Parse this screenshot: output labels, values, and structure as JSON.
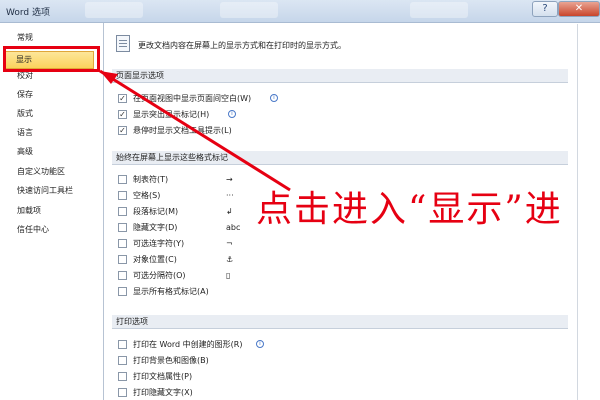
{
  "window": {
    "title": "Word 选项",
    "help_glyph": "?",
    "close_glyph": "✕"
  },
  "sidebar": {
    "items": [
      {
        "label": "常规",
        "selected": false
      },
      {
        "label": "显示",
        "selected": true
      },
      {
        "label": "校对",
        "selected": false
      },
      {
        "label": "保存",
        "selected": false
      },
      {
        "label": "版式",
        "selected": false
      },
      {
        "label": "语言",
        "selected": false
      },
      {
        "label": "高级",
        "selected": false
      },
      {
        "label": "自定义功能区",
        "selected": false
      },
      {
        "label": "快速访问工具栏",
        "selected": false
      },
      {
        "label": "加载项",
        "selected": false
      },
      {
        "label": "信任中心",
        "selected": false
      }
    ]
  },
  "main": {
    "intro": "更改文档内容在屏幕上的显示方式和在打印时的显示方式。",
    "page_display": {
      "header": "页面显示选项",
      "options": [
        {
          "label": "在页面视图中显示页面间空白(W)",
          "checked": true,
          "info": true
        },
        {
          "label": "显示突出显示标记(H)",
          "checked": true,
          "info": true
        },
        {
          "label": "悬停时显示文档工具提示(L)",
          "checked": true,
          "info": false
        }
      ]
    },
    "formatting_marks": {
      "header": "始终在屏幕上显示这些格式标记",
      "options": [
        {
          "label": "制表符(T)",
          "checked": false,
          "symbol": "→"
        },
        {
          "label": "空格(S)",
          "checked": false,
          "symbol": "···"
        },
        {
          "label": "段落标记(M)",
          "checked": false,
          "symbol": "↲"
        },
        {
          "label": "隐藏文字(D)",
          "checked": false,
          "symbol": "abc"
        },
        {
          "label": "可选连字符(Y)",
          "checked": false,
          "symbol": "¬"
        },
        {
          "label": "对象位置(C)",
          "checked": false,
          "symbol": "⚓"
        },
        {
          "label": "可选分隔符(O)",
          "checked": false,
          "symbol": "▯"
        },
        {
          "label": "显示所有格式标记(A)",
          "checked": false,
          "symbol": ""
        }
      ]
    },
    "print_options": {
      "header": "打印选项",
      "options": [
        {
          "label": "打印在 Word 中创建的图形(R)",
          "checked": false,
          "info": true
        },
        {
          "label": "打印背景色和图像(B)",
          "checked": false,
          "info": false
        },
        {
          "label": "打印文档属性(P)",
          "checked": false,
          "info": false
        },
        {
          "label": "打印隐藏文字(X)",
          "checked": false,
          "info": false
        }
      ]
    }
  },
  "annotation": {
    "text": "点击进入“显示”进",
    "color": "#e60012"
  },
  "colors": {
    "selected_bg": "#fbd35c",
    "annotation": "#e60012",
    "section_bg": "#e9edf3"
  }
}
